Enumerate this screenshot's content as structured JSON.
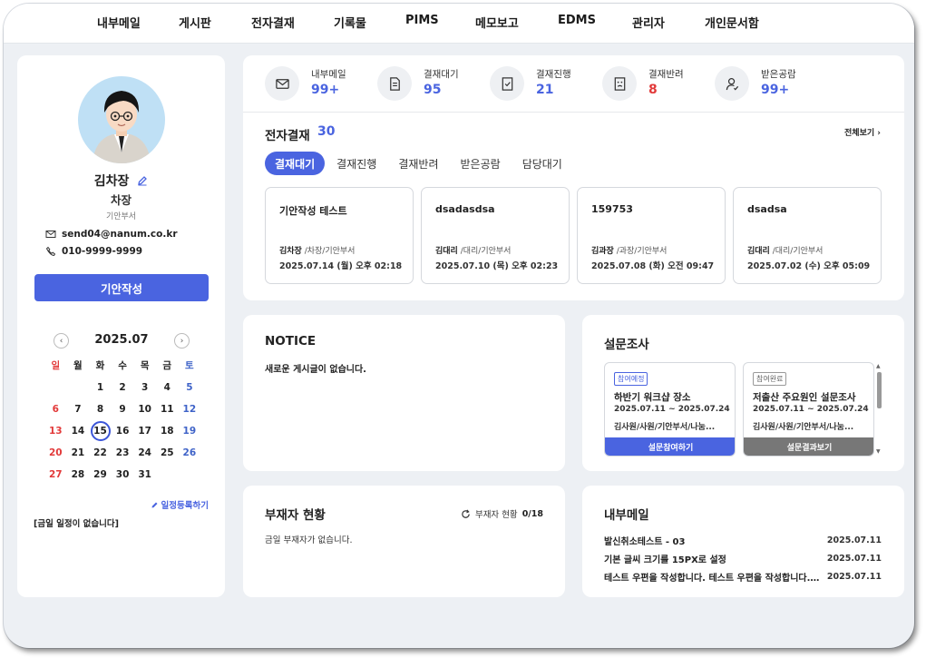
{
  "nav": [
    "내부메일",
    "게시판",
    "전자결재",
    "기록물",
    "PIMS",
    "메모보고",
    "EDMS",
    "관리자",
    "개인문서함"
  ],
  "profile": {
    "name": "김차장",
    "rank": "차장",
    "dept": "기안부서",
    "email": "send04@nanum.co.kr",
    "phone": "010-9999-9999",
    "write_button": "기안작성"
  },
  "calendar": {
    "title": "2025.07",
    "weekdays": [
      "일",
      "월",
      "화",
      "수",
      "목",
      "금",
      "토"
    ],
    "weeks": [
      [
        "",
        "",
        "1",
        "2",
        "3",
        "4",
        "5"
      ],
      [
        "6",
        "7",
        "8",
        "9",
        "10",
        "11",
        "12"
      ],
      [
        "13",
        "14",
        "15",
        "16",
        "17",
        "18",
        "19"
      ],
      [
        "20",
        "21",
        "22",
        "23",
        "24",
        "25",
        "26"
      ],
      [
        "27",
        "28",
        "29",
        "30",
        "31",
        "",
        ""
      ]
    ],
    "today": "15",
    "schedule_link": "일정등록하기",
    "schedule_empty": "[금일 일정이 없습니다]"
  },
  "stats": [
    {
      "label": "내부메일",
      "value": "99+",
      "icon": "mail-icon",
      "color": "#4a64e0"
    },
    {
      "label": "결재대기",
      "value": "95",
      "icon": "document-icon",
      "color": "#4a64e0"
    },
    {
      "label": "결재진행",
      "value": "21",
      "icon": "check-document-icon",
      "color": "#4a64e0"
    },
    {
      "label": "결재반려",
      "value": "8",
      "icon": "rejected-document-icon",
      "color": "#e23a3a"
    },
    {
      "label": "받은공람",
      "value": "99+",
      "icon": "user-check-icon",
      "color": "#4a64e0"
    }
  ],
  "approval": {
    "title": "전자결재",
    "count": "30",
    "view_all": "전체보기",
    "tabs": [
      "결재대기",
      "결재진행",
      "결재반려",
      "받은공람",
      "담당대기"
    ],
    "docs": [
      {
        "title": "기안작성 테스트",
        "author": "김차장",
        "role": " /차장/기안부서",
        "date": "2025.07.14 (월) 오후 02:18"
      },
      {
        "title": "dsadasdsa",
        "author": "김대리",
        "role": " /대리/기안부서",
        "date": "2025.07.10 (목) 오후 02:23"
      },
      {
        "title": "159753",
        "author": "김과장",
        "role": " /과장/기안부서",
        "date": "2025.07.08 (화) 오전 09:47"
      },
      {
        "title": "dsadsa",
        "author": "김대리",
        "role": " /대리/기안부서",
        "date": "2025.07.02 (수) 오후 05:09"
      }
    ]
  },
  "notice": {
    "title": "NOTICE",
    "empty": "새로운 게시글이 없습니다."
  },
  "survey": {
    "title": "설문조사",
    "items": [
      {
        "badge": "참여예정",
        "title": "하반기 워크샵 장소",
        "period": "2025.07.11 ~ 2025.07.24",
        "target": "김사원/사원/기안부서/나눔...",
        "button": "설문참여하기"
      },
      {
        "badge": "참여완료",
        "title": "저출산 주요원인 설문조사",
        "period": "2025.07.11 ~ 2025.07.24",
        "target": "김사원/사원/기안부서/나눔...",
        "button": "설문결과보기"
      }
    ]
  },
  "absence": {
    "title": "부재자 현황",
    "status_label": "부재자 현황",
    "status_value": "0/18",
    "empty": "금일 부재자가 없습니다."
  },
  "mail": {
    "title": "내부메일",
    "items": [
      {
        "subject": "발신취소테스트 - 03",
        "date": "2025.07.11"
      },
      {
        "subject": "기본 글씨 크기를 15PX로 설정",
        "date": "2025.07.11"
      },
      {
        "subject": "테스트 우편을 작성합니다. 테스트 우편을 작성합니다. 테스트 우편을 작성합니다.",
        "date": "2025.07.11"
      }
    ]
  }
}
